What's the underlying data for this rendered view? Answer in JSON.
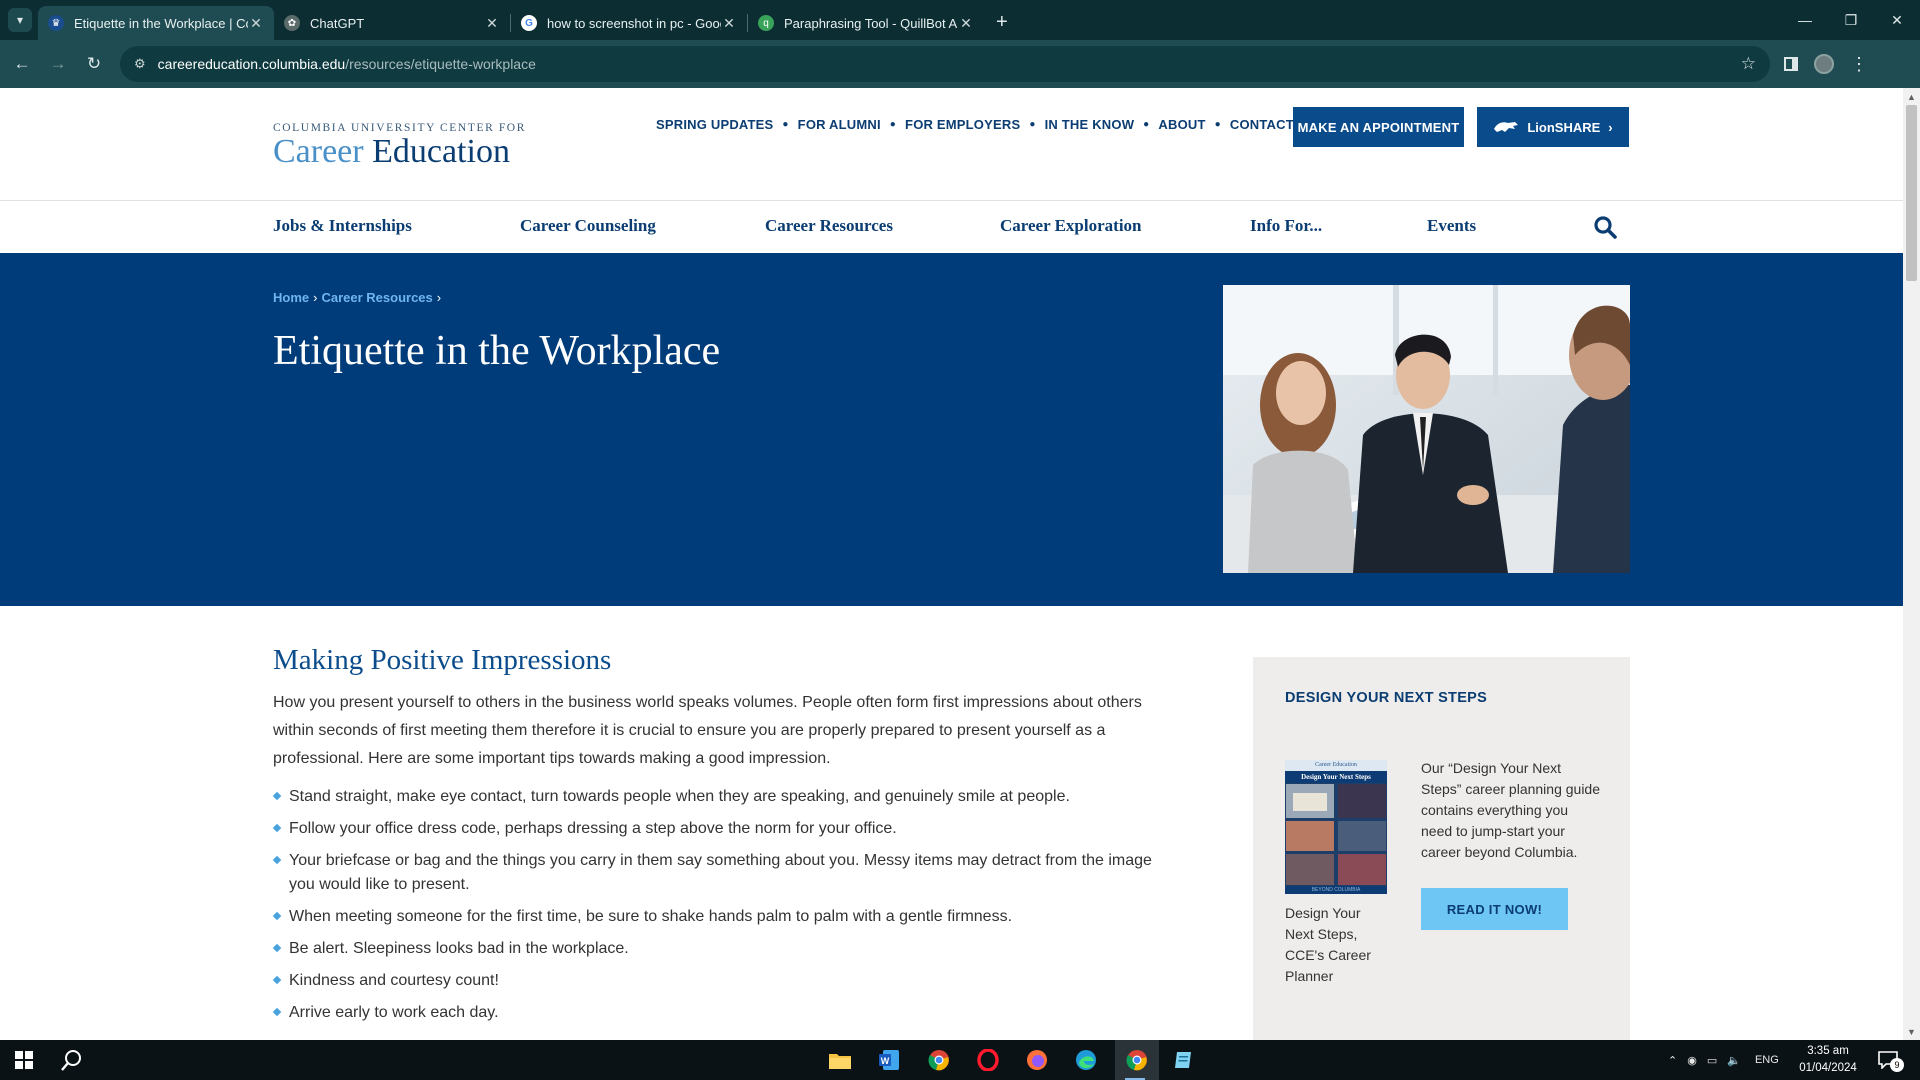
{
  "browser": {
    "tabs": [
      {
        "title": "Etiquette in the Workplace | Co",
        "active": true,
        "icon": "columbia-crown-icon"
      },
      {
        "title": "ChatGPT",
        "active": false,
        "icon": "chatgpt-icon"
      },
      {
        "title": "how to screenshot in pc - Goog",
        "active": false,
        "icon": "google-icon"
      },
      {
        "title": "Paraphrasing Tool - QuillBot AI",
        "active": false,
        "icon": "quillbot-icon"
      }
    ],
    "url_domain": "careereducation.columbia.edu",
    "url_path": "/resources/etiquette-workplace"
  },
  "site": {
    "logo_line1": "COLUMBIA UNIVERSITY CENTER FOR",
    "logo_word1": "Career",
    "logo_word2": "Education",
    "utility_links": [
      "SPRING UPDATES",
      "FOR ALUMNI",
      "FOR EMPLOYERS",
      "IN THE KNOW",
      "ABOUT",
      "CONTACT"
    ],
    "appointment_button": "MAKE AN APPOINTMENT",
    "lionshare_button": "LionSHARE",
    "main_nav": [
      "Jobs & Internships",
      "Career Counseling",
      "Career Resources",
      "Career Exploration",
      "Info For...",
      "Events"
    ]
  },
  "hero": {
    "breadcrumbs": [
      "Home",
      "Career Resources"
    ],
    "title": "Etiquette in the Workplace"
  },
  "content": {
    "heading": "Making Positive Impressions",
    "intro": "How you present yourself to others in the business world speaks volumes. People often form first impressions about others within seconds of first meeting them therefore it is crucial to ensure you are properly prepared to present yourself as a professional. Here are some important tips towards making a good impression.",
    "tips": [
      "Stand straight, make eye contact, turn towards people when they are speaking, and genuinely smile at people.",
      "Follow your office dress code, perhaps dressing a step above the norm for your office.",
      "Your briefcase or bag and the things you carry in them say something about you. Messy items may detract from the image you would like to present.",
      "When meeting someone for the first time, be sure to shake hands palm to palm with a gentle firmness.",
      "Be alert. Sleepiness looks bad in the workplace.",
      "Kindness and courtesy count!",
      "Arrive early to work each day."
    ]
  },
  "sidebar": {
    "heading": "DESIGN YOUR NEXT STEPS",
    "book_top": "Career Education",
    "book_title": "Design Your Next Steps",
    "book_footer": "BEYOND COLUMBIA",
    "caption": "Design Your Next Steps, CCE's Career Planner",
    "blurb": "Our “Design Your Next Steps” career planning guide contains everything you need to jump-start your career beyond Columbia.",
    "button": "READ IT NOW!"
  },
  "taskbar": {
    "apps": [
      "start-icon",
      "search-icon",
      "file-explorer-icon",
      "word-icon",
      "chrome-icon",
      "opera-icon",
      "firefox-icon",
      "edge-icon",
      "chrome-active-icon",
      "notepad-icon"
    ],
    "language": "ENG",
    "time": "3:35 am",
    "date": "01/04/2024",
    "notification_count": "9"
  },
  "colors": {
    "brand_navy": "#003c7a",
    "button_blue": "#0a4b8c",
    "accent_light_blue": "#6ec6f5",
    "chrome_teal": "#1f4c52"
  }
}
